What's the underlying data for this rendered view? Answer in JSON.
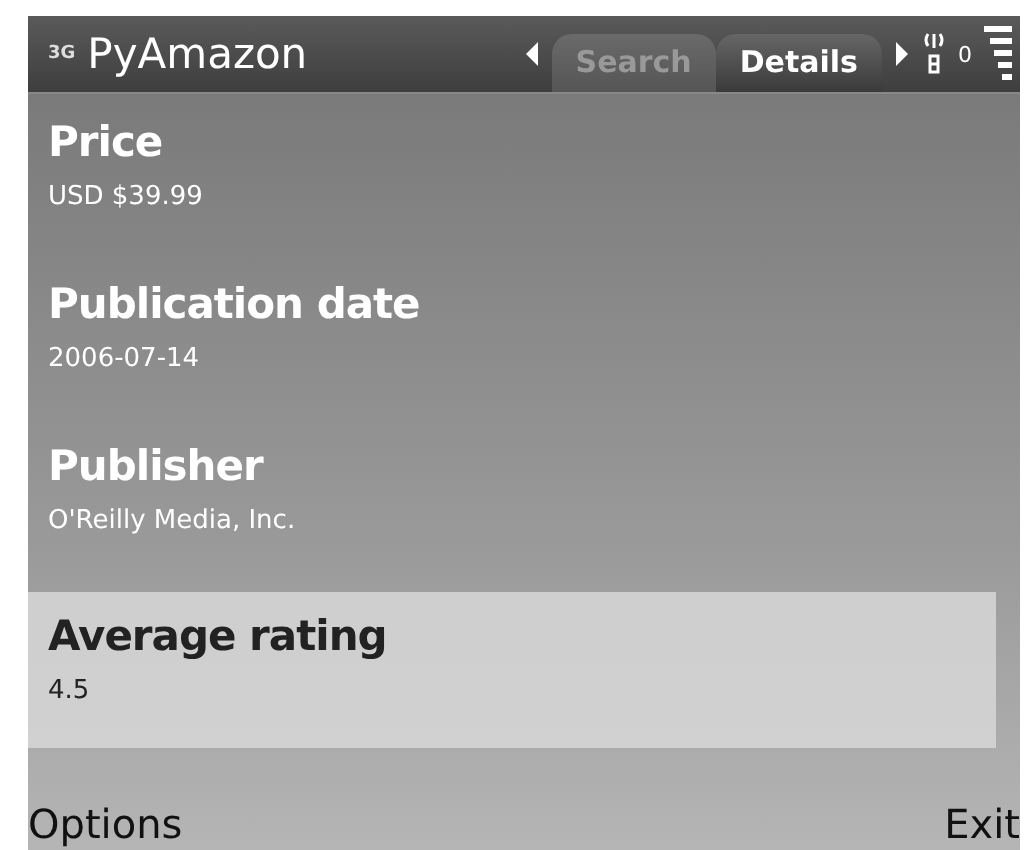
{
  "status_bar": {
    "network": "3G",
    "title": "PyAmazon",
    "tabs": [
      {
        "label": "Search",
        "selected": false
      },
      {
        "label": "Details",
        "selected": true
      }
    ],
    "counter": "0"
  },
  "items": [
    {
      "label": "Price",
      "value": "USD $39.99",
      "selected": false
    },
    {
      "label": "Publication date",
      "value": "2006-07-14",
      "selected": false
    },
    {
      "label": "Publisher",
      "value": "O'Reilly Media, Inc.",
      "selected": false
    },
    {
      "label": "Average rating",
      "value": "4.5",
      "selected": true
    }
  ],
  "softkeys": {
    "left": "Options",
    "right": "Exit"
  }
}
